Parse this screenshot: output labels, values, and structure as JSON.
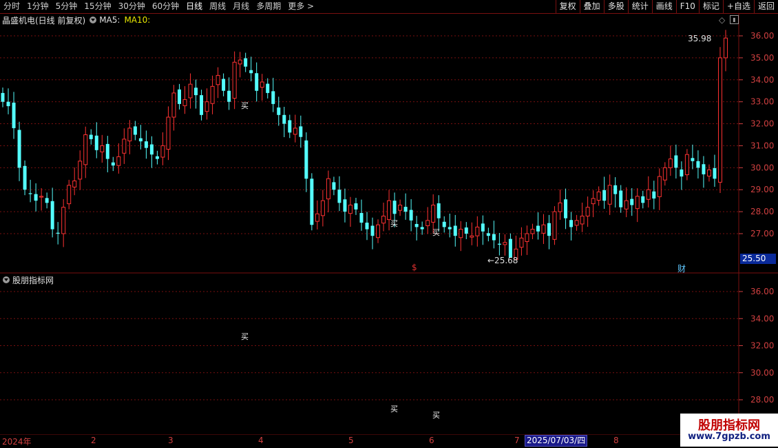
{
  "toolbar": {
    "periods": [
      "分时",
      "1分钟",
      "5分钟",
      "15分钟",
      "30分钟",
      "60分钟",
      "日线",
      "周线",
      "月线",
      "多周期",
      "更多 >"
    ],
    "buttons": [
      "复权",
      "叠加",
      "多股",
      "统计",
      "画线",
      "F10",
      "标记",
      "+自选",
      "返回"
    ]
  },
  "header": {
    "stock_title": "晶盛机电(日线 前复权)",
    "ma5_label": "MA5:",
    "ma10_label": "MA10:"
  },
  "sub_panel": {
    "title": "股朋指标网",
    "buy_label": "买"
  },
  "main_axis": {
    "ticks": [
      "36.00",
      "35.00",
      "34.00",
      "33.00",
      "32.00",
      "31.00",
      "30.00",
      "29.00",
      "28.00",
      "27.00"
    ]
  },
  "sub_axis": {
    "ticks": [
      "36.00",
      "34.00",
      "32.00",
      "30.00",
      "28.00"
    ]
  },
  "annotations": {
    "high_label": "35.98",
    "low_label": "←25.68",
    "last_price": "25.50",
    "event_s": "$",
    "event_cai": "财"
  },
  "date_axis": {
    "labels": [
      "2024年",
      "2",
      "3",
      "4",
      "5",
      "6",
      "7",
      "8"
    ],
    "selected": "2025/07/03/四"
  },
  "watermark": {
    "line1": "股朋指标网",
    "line2": "www.7gpzb.com"
  },
  "colors": {
    "up": "#ff3232",
    "down": "#54ffff",
    "grid": "#7a1010",
    "axis": "#d04040"
  },
  "chart_data": {
    "type": "candlestick",
    "y_range": [
      26.0,
      36.5
    ],
    "high": 35.98,
    "low": 25.68,
    "closes": [
      33.0,
      32.8,
      31.8,
      30.0,
      29.0,
      28.8,
      28.5,
      28.7,
      28.4,
      27.2,
      27.0,
      28.2,
      29.2,
      29.4,
      30.3,
      31.5,
      31.3,
      30.8,
      31.0,
      30.4,
      30.1,
      30.5,
      31.3,
      31.8,
      31.5,
      31.2,
      30.9,
      30.6,
      30.4,
      31.0,
      32.3,
      33.4,
      32.9,
      33.1,
      33.8,
      33.3,
      32.4,
      33.0,
      33.7,
      34.2,
      33.5,
      33.0,
      34.8,
      34.9,
      34.6,
      34.3,
      33.5,
      33.9,
      33.4,
      32.9,
      32.4,
      32.0,
      31.6,
      31.8,
      31.4,
      29.5,
      27.4,
      27.9,
      28.5,
      29.5,
      29.0,
      28.4,
      28.0,
      28.3,
      28.1,
      27.5,
      27.2,
      26.9,
      27.4,
      27.8,
      28.5,
      27.9,
      28.3,
      28.0,
      27.6,
      27.3,
      27.2,
      27.6,
      28.3,
      27.7,
      27.3,
      27.2,
      26.9,
      27.2,
      27.0,
      26.9,
      27.3,
      27.1,
      26.9,
      26.7,
      26.5,
      26.6,
      25.9,
      26.3,
      26.8,
      27.0,
      27.2,
      27.1,
      27.4,
      26.9,
      28.0,
      28.4,
      27.7,
      27.3,
      27.6,
      27.8,
      28.2,
      28.6,
      28.9,
      28.5,
      29.2,
      28.8,
      28.2,
      28.5,
      28.3,
      28.7,
      28.4,
      29.0,
      28.6,
      29.6,
      30.0,
      30.4,
      30.0,
      29.6,
      30.6,
      30.3,
      30.0,
      29.7,
      29.9,
      29.5,
      35.0,
      35.9
    ],
    "ma_series": [],
    "sub_buy_markers": 3
  }
}
